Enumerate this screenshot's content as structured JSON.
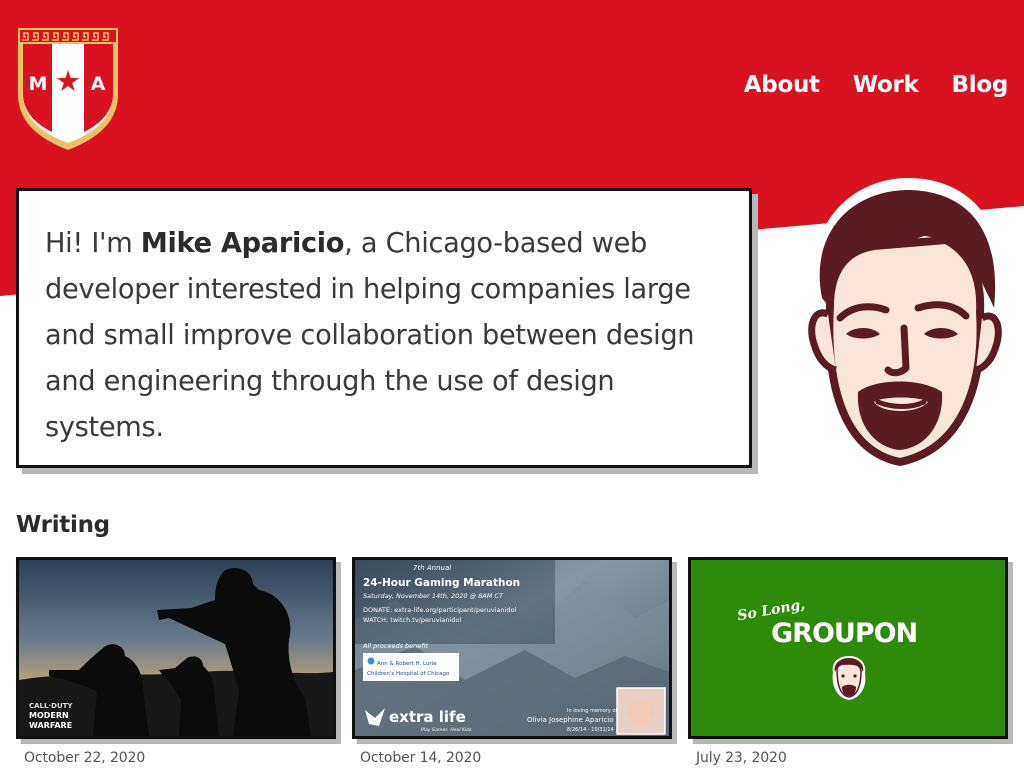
{
  "brand": {
    "logo_left_letter": "M",
    "logo_right_letter": "A",
    "colors": {
      "primary_red": "#d8121f",
      "gold": "#e8c16a",
      "white": "#ffffff",
      "ink": "#111111"
    }
  },
  "nav": {
    "items": [
      "About",
      "Work",
      "Blog"
    ]
  },
  "intro": {
    "pre": "Hi! I'm ",
    "name": "Mike Aparicio",
    "post": ", a Chicago-based web developer interested in helping companies large and small improve collaboration between design and engineering through the use of design systems."
  },
  "writing": {
    "heading": "Writing",
    "posts": [
      {
        "date": "October 22, 2020",
        "image": {
          "icon": "soldiers-silhouette-image",
          "game_logo_line1": "CALL·DUTY",
          "game_logo_line2": "MODERN",
          "game_logo_line3": "WARFARE"
        }
      },
      {
        "date": "October 14, 2020",
        "image": {
          "icon": "mountain-map-image",
          "annual": "7th Annual",
          "title": "24-Hour Gaming Marathon",
          "when": "Saturday, November 14th, 2020 @ 8AM CT",
          "donate": "DONATE: extra-life.org/participant/peruvianidol",
          "watch": "WATCH: twitch.tv/peruvianidol",
          "benefit": "All proceeds benefit",
          "hospital_line1": "Ann & Robert H. Lurie",
          "hospital_line2": "Children's Hospital of Chicago",
          "extra_life": "extra life",
          "extra_life_tag": "Play Games. Heal Kids.",
          "memory_label": "In loving memory of",
          "memory_name": "Olivia Josephine Aparicio",
          "memory_dates": "8/26/14 - 10/31/14"
        }
      },
      {
        "date": "July 23, 2020",
        "image": {
          "icon": "groupon-farewell-image",
          "so_long": "So Long,",
          "brand": "GROUPON"
        }
      }
    ]
  }
}
